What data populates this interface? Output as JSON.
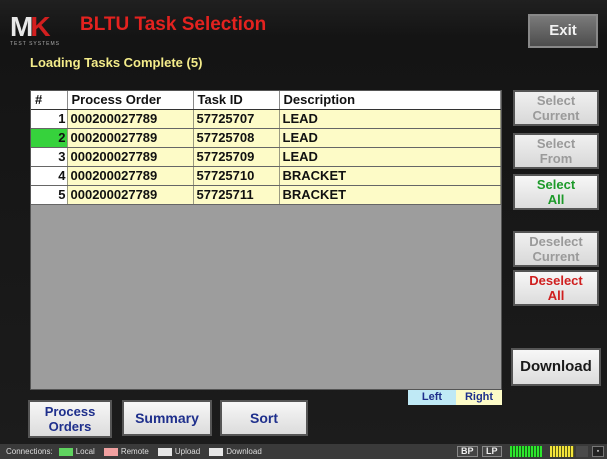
{
  "header": {
    "logo_text": "MK",
    "logo_subtext": "TEST SYSTEMS",
    "title": "BLTU Task Selection",
    "exit_label": "Exit"
  },
  "status": {
    "text": "Loading Tasks Complete (5)"
  },
  "table": {
    "columns": [
      "#",
      "Process Order",
      "Task ID",
      "Description"
    ],
    "rows": [
      {
        "num": "1",
        "process_order": "000200027789",
        "task_id": "57725707",
        "description": "LEAD",
        "selected": false
      },
      {
        "num": "2",
        "process_order": "000200027789",
        "task_id": "57725708",
        "description": "LEAD",
        "selected": true
      },
      {
        "num": "3",
        "process_order": "000200027789",
        "task_id": "57725709",
        "description": "LEAD",
        "selected": false
      },
      {
        "num": "4",
        "process_order": "000200027789",
        "task_id": "57725710",
        "description": "BRACKET",
        "selected": false
      },
      {
        "num": "5",
        "process_order": "000200027789",
        "task_id": "57725711",
        "description": "BRACKET",
        "selected": false
      }
    ]
  },
  "side_buttons": {
    "select_current": [
      "Select",
      "Current"
    ],
    "select_from": [
      "Select",
      "From"
    ],
    "select_all": [
      "Select",
      "All"
    ],
    "deselect_current": [
      "Deselect",
      "Current"
    ],
    "deselect_all": [
      "Deselect",
      "All"
    ],
    "download": "Download"
  },
  "legend": {
    "left": "Left",
    "right": "Right"
  },
  "bottom_buttons": {
    "process_orders": [
      "Process",
      "Orders"
    ],
    "summary": "Summary",
    "sort": "Sort"
  },
  "status_bar": {
    "connections_label": "Connections:",
    "items": [
      {
        "label": "Local",
        "color": "#5fd35f"
      },
      {
        "label": "Remote",
        "color": "#f0a0a0"
      },
      {
        "label": "Upload",
        "color": "#e6e6e6"
      },
      {
        "label": "Download",
        "color": "#e6e6e6"
      }
    ],
    "bp": "BP",
    "lp": "LP"
  },
  "colors": {
    "title_red": "#e3221f",
    "status_yellow": "#f4ec8a",
    "row_bg": "#fdfbc7",
    "selected_green": "#36d23c",
    "button_blue": "#1e2f8c"
  }
}
